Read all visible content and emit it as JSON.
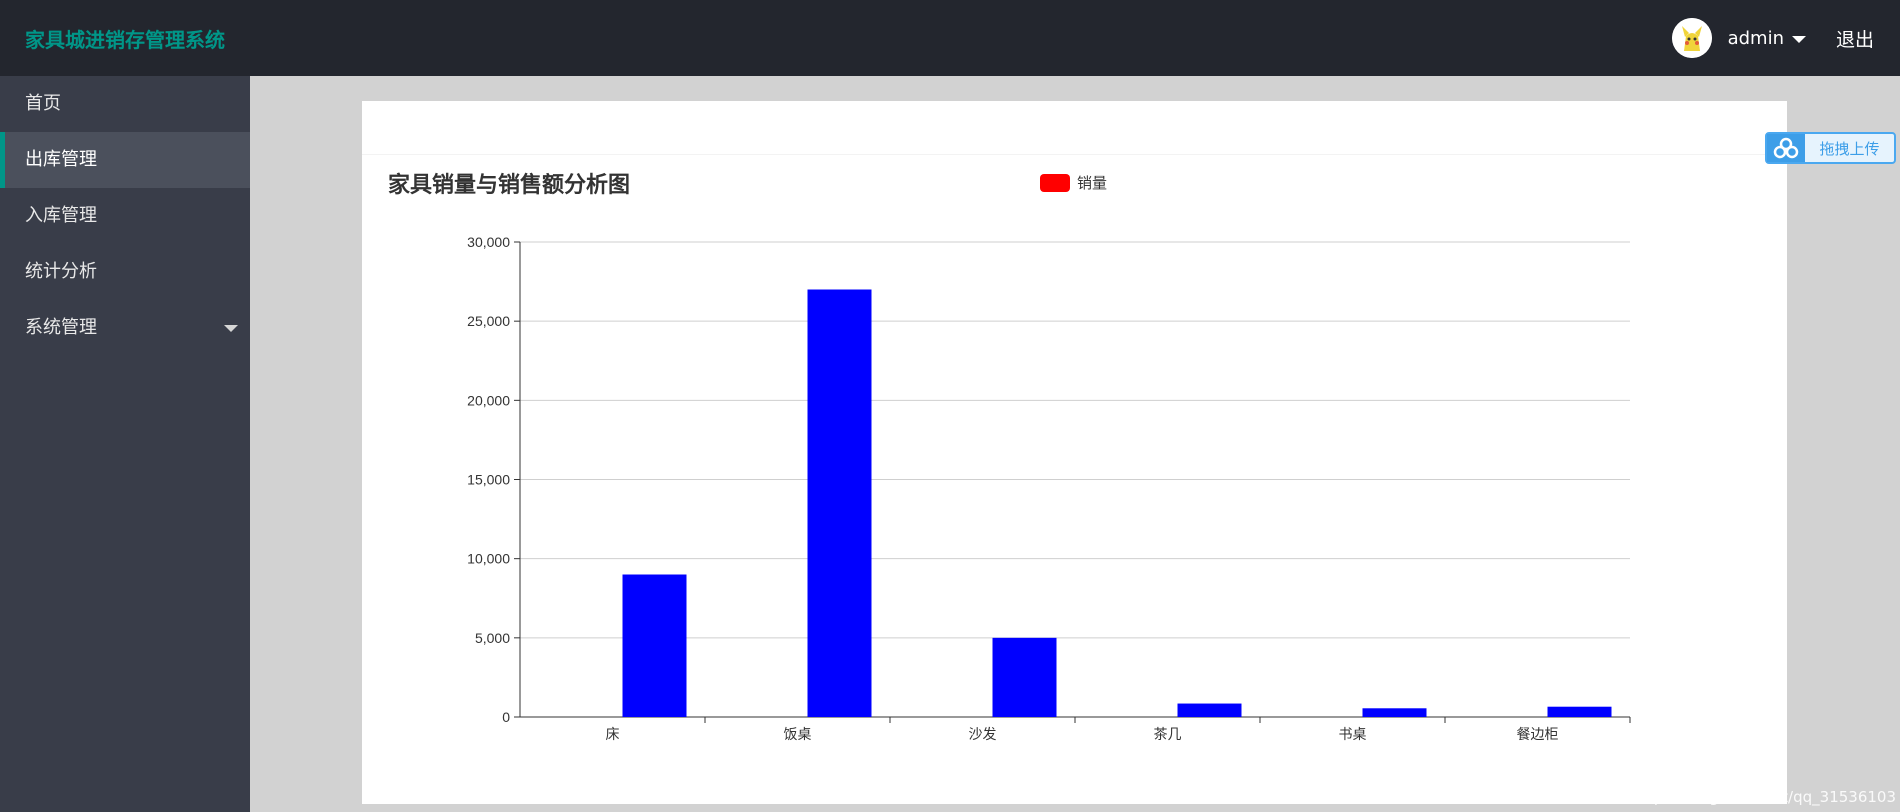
{
  "header": {
    "brand": "家具城进销存管理系统",
    "username": "admin",
    "logout_label": "退出"
  },
  "sidebar": {
    "items": [
      {
        "label": "首页"
      },
      {
        "label": "出库管理"
      },
      {
        "label": "入库管理"
      },
      {
        "label": "统计分析"
      },
      {
        "label": "系统管理"
      }
    ]
  },
  "upload_widget": {
    "label": "拖拽上传"
  },
  "watermark": "https://blog.csdn.net/qq_31536103",
  "colors": {
    "brand": "#009688",
    "bar": "#0000ff",
    "legend": "#ff0000"
  },
  "chart_data": {
    "type": "bar",
    "title": "家具销量与销售额分析图",
    "categories": [
      "床",
      "饭桌",
      "沙发",
      "茶几",
      "书桌",
      "餐边柜"
    ],
    "series": [
      {
        "name": "销量",
        "values": [
          9000,
          27000,
          5000,
          850,
          550,
          650
        ]
      }
    ],
    "ylim": [
      0,
      30000
    ],
    "yticks": [
      0,
      5000,
      10000,
      15000,
      20000,
      25000,
      30000
    ],
    "ytick_labels": [
      "0",
      "5,000",
      "10,000",
      "15,000",
      "20,000",
      "25,000",
      "30,000"
    ],
    "grid": true,
    "legend_position": "top-center"
  }
}
